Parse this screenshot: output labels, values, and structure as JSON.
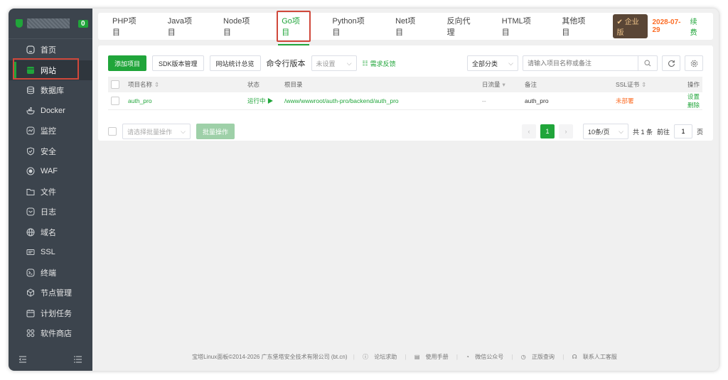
{
  "sidebar": {
    "badge": "0",
    "items": [
      {
        "label": "首页",
        "icon": "home-icon"
      },
      {
        "label": "网站",
        "icon": "website-icon",
        "active": true
      },
      {
        "label": "数据库",
        "icon": "database-icon"
      },
      {
        "label": "Docker",
        "icon": "docker-icon"
      },
      {
        "label": "监控",
        "icon": "monitor-icon"
      },
      {
        "label": "安全",
        "icon": "shield-icon"
      },
      {
        "label": "WAF",
        "icon": "waf-icon"
      },
      {
        "label": "文件",
        "icon": "folder-icon"
      },
      {
        "label": "日志",
        "icon": "log-icon"
      },
      {
        "label": "域名",
        "icon": "globe-icon"
      },
      {
        "label": "SSL",
        "icon": "ssl-icon"
      },
      {
        "label": "终端",
        "icon": "terminal-icon"
      },
      {
        "label": "节点管理",
        "icon": "node-icon"
      },
      {
        "label": "计划任务",
        "icon": "calendar-icon"
      },
      {
        "label": "软件商店",
        "icon": "apps-icon"
      }
    ]
  },
  "tabs": [
    "PHP项目",
    "Java项目",
    "Node项目",
    "Go项目",
    "Python项目",
    "Net项目",
    "反向代理",
    "HTML项目",
    "其他项目"
  ],
  "active_tab": "Go项目",
  "header": {
    "enterprise_label": "企业版",
    "expire_date": "2028-07-29",
    "renew_label": "续费"
  },
  "toolbar": {
    "add_label": "添加项目",
    "sdk_label": "SDK版本管理",
    "stats_label": "网站统计总览",
    "cmd_label": "命令行版本",
    "cmd_select": "未设置",
    "feedback_label": "需求反馈",
    "category_select": "全部分类",
    "search_placeholder": "请输入项目名称或备注"
  },
  "table": {
    "headers": {
      "name": "项目名称",
      "status": "状态",
      "root": "根目录",
      "traffic": "日流量",
      "remark": "备注",
      "ssl": "SSL证书",
      "ops": "操作"
    },
    "rows": [
      {
        "name": "auth_pro",
        "status": "运行中 ▶",
        "root": "/www/wwwroot/auth-pro/backend/auth_pro",
        "traffic": "--",
        "remark": "auth_pro",
        "ssl": "未部署",
        "op_settings": "设置",
        "op_delete": "删除"
      }
    ]
  },
  "bottom": {
    "batch_select": "请选择批量操作",
    "batch_btn": "批量操作",
    "page_current": "1",
    "page_size": "10条/页",
    "total": "共 1 条",
    "goto_label": "前往",
    "goto_value": "1",
    "page_unit": "页"
  },
  "footer": {
    "copyright": "宝塔Linux面板©2014-2026 广东堡塔安全技术有限公司 (bt.cn)",
    "links": [
      "论坛求助",
      "使用手册",
      "微信公众号",
      "正版查询",
      "联系人工客服"
    ]
  }
}
